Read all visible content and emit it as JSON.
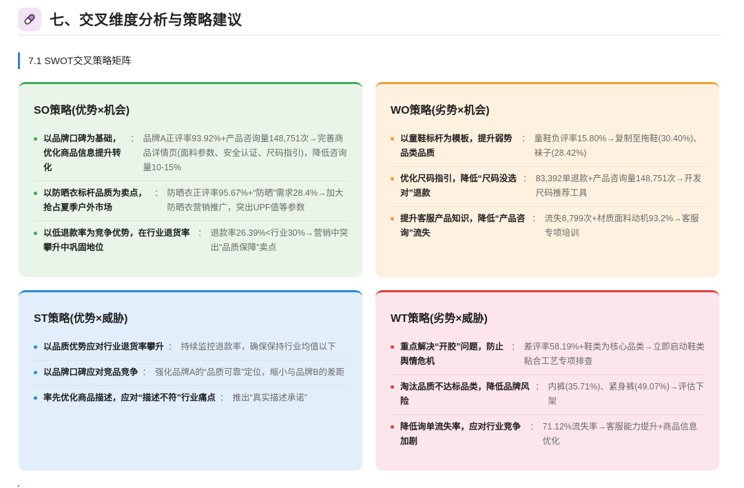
{
  "header": {
    "icon": "pill-icon",
    "title": "七、交叉维度分析与策略建议"
  },
  "section": {
    "title": "7.1 SWOT交叉策略矩阵"
  },
  "colors": {
    "so": "#3cab52",
    "wo": "#f49b2e",
    "st": "#2b88d8",
    "wt": "#e23c3c"
  },
  "so": {
    "title": "SO策略(优势×机会)",
    "items": [
      {
        "head": "以品牌口碑为基础，优化商品信息提升转化",
        "body": "品牌A正评率93.92%+产品咨询量148,751次→完善商品详情页(面料参数、安全认证、尺码指引)，降低咨询量10-15%"
      },
      {
        "head": "以防晒衣标杆品质为卖点，抢占夏季户外市场",
        "body": "防晒衣正评率95.67%+“防晒”需求28.4%→加大防晒衣营销推广，突出UPF值等参数"
      },
      {
        "head": "以低退款率为竞争优势，在行业退货率攀升中巩固地位",
        "body": "退款率26.39%<行业30%→营销中突出“品质保障”卖点"
      }
    ]
  },
  "wo": {
    "title": "WO策略(劣势×机会)",
    "items": [
      {
        "head": "以童鞋标杆为模板，提升弱势品类品质",
        "body": "童鞋负评率15.80%→复制至拖鞋(30.40%)、袜子(28.42%)"
      },
      {
        "head": "优化尺码指引，降低“尺码没选对”退款",
        "body": "83,392单退款+产品咨询量148,751次→开发尺码推荐工具"
      },
      {
        "head": "提升客服产品知识，降低“产品咨询”流失",
        "body": "流失8,799次+材质面料动机93.2%→客服专项培训"
      }
    ]
  },
  "st": {
    "title": "ST策略(优势×威胁)",
    "items": [
      {
        "head": "以品质优势应对行业退货率攀升",
        "body": "持续监控退款率，确保保持行业均值以下"
      },
      {
        "head": "以品牌口碑应对竞品竞争",
        "body": "强化品牌A的“品质可靠”定位，缩小与品牌B的差距"
      },
      {
        "head": "率先优化商品描述，应对“描述不符”行业痛点",
        "body": "推出“真实描述承诺”"
      }
    ]
  },
  "wt": {
    "title": "WT策略(劣势×威胁)",
    "items": [
      {
        "head": "重点解决“开胶”问题，防止舆情危机",
        "body": "差评率58.19%+鞋类为核心品类→立即启动鞋类粘合工艺专项排查"
      },
      {
        "head": "淘汰品质不达标品类，降低品牌风险",
        "body": "内裤(35.71%)、紧身裤(49.07%)→评估下架"
      },
      {
        "head": "降低询单流失率，应对行业竞争加剧",
        "body": "71.12%流失率→客服能力提升+商品信息优化"
      }
    ]
  }
}
